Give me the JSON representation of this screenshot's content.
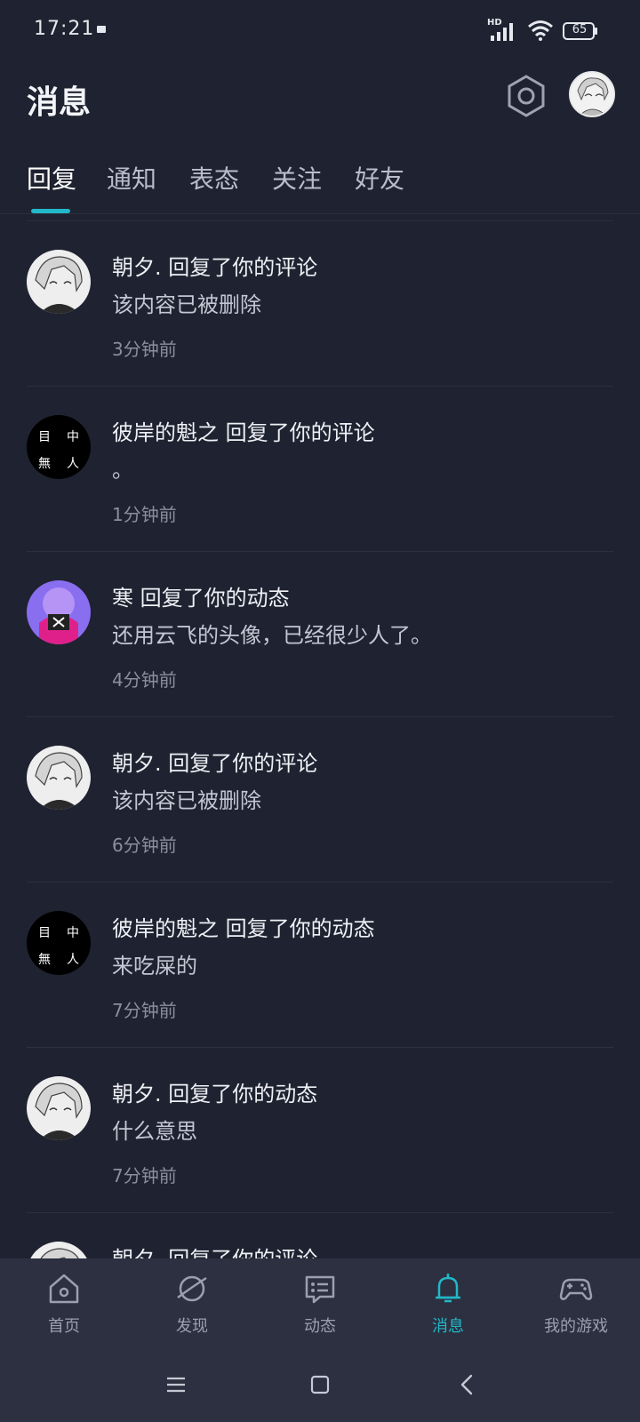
{
  "status_bar": {
    "time": "17:21",
    "network": "HD",
    "battery": "65"
  },
  "header": {
    "title": "消息"
  },
  "tabs": [
    {
      "label": "回复",
      "active": true
    },
    {
      "label": "通知",
      "active": false
    },
    {
      "label": "表态",
      "active": false
    },
    {
      "label": "关注",
      "active": false
    },
    {
      "label": "好友",
      "active": false
    }
  ],
  "messages": [
    {
      "user": "朝夕.",
      "action": "回复了你的评论",
      "title": "朝夕. 回复了你的评论",
      "content": "该内容已被删除",
      "time": "3分钟前",
      "avatar": "sketch-portrait"
    },
    {
      "user": "彼岸的魁之",
      "action": "回复了你的评论",
      "title": "彼岸的魁之 回复了你的评论",
      "content": "。",
      "time": "1分钟前",
      "avatar": "black-text-avatar",
      "avatar_text": [
        "目",
        "中",
        "無",
        "人"
      ]
    },
    {
      "user": "寒",
      "action": "回复了你的动态",
      "title": "寒 回复了你的动态",
      "content": "还用云飞的头像，已经很少人了。",
      "time": "4分钟前",
      "avatar": "purple-character"
    },
    {
      "user": "朝夕.",
      "action": "回复了你的评论",
      "title": "朝夕. 回复了你的评论",
      "content": "该内容已被删除",
      "time": "6分钟前",
      "avatar": "sketch-portrait"
    },
    {
      "user": "彼岸的魁之",
      "action": "回复了你的动态",
      "title": "彼岸的魁之 回复了你的动态",
      "content": "来吃屎的",
      "time": "7分钟前",
      "avatar": "black-text-avatar",
      "avatar_text": [
        "目",
        "中",
        "無",
        "人"
      ]
    },
    {
      "user": "朝夕.",
      "action": "回复了你的动态",
      "title": "朝夕. 回复了你的动态",
      "content": "什么意思",
      "time": "7分钟前",
      "avatar": "sketch-portrait"
    },
    {
      "user": "朝夕.",
      "action": "回复了你的评论",
      "title": "朝夕. 回复了你的评论",
      "content": "",
      "time": "",
      "avatar": "sketch-portrait"
    }
  ],
  "bottom_nav": [
    {
      "label": "首页",
      "icon": "home-icon",
      "active": false
    },
    {
      "label": "发现",
      "icon": "planet-icon",
      "active": false
    },
    {
      "label": "动态",
      "icon": "chat-card-icon",
      "active": false
    },
    {
      "label": "消息",
      "icon": "bell-icon",
      "active": true
    },
    {
      "label": "我的游戏",
      "icon": "gamepad-icon",
      "active": false
    }
  ],
  "colors": {
    "background": "#1f2230",
    "accent": "#22b8c8",
    "nav_background": "#2c3040"
  }
}
